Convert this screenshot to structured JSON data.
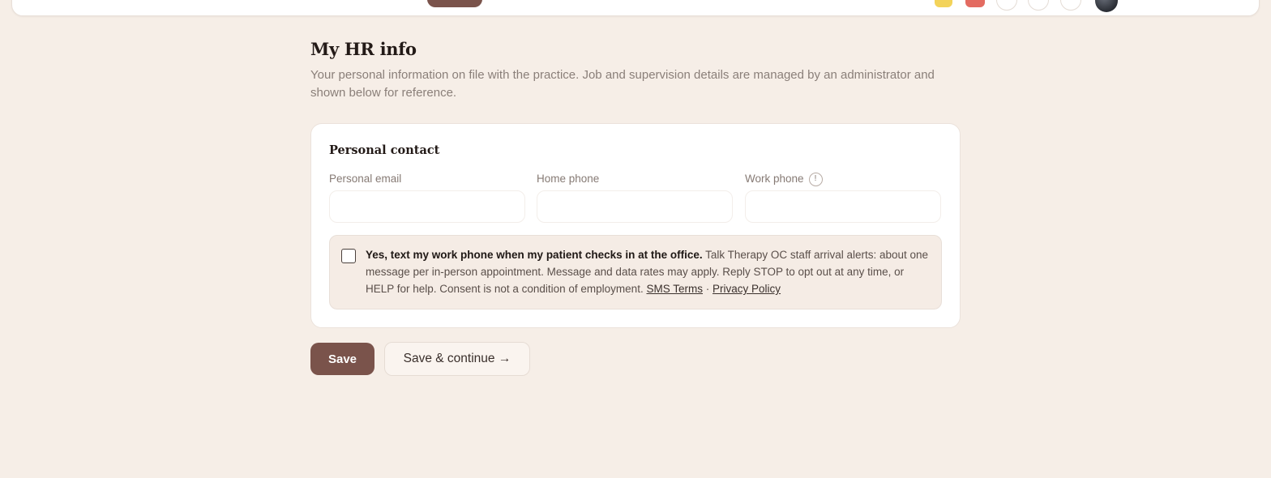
{
  "page": {
    "title": "My HR info",
    "subtitle": "Your personal information on file with the practice. Job and supervision details are managed by an administrator and shown below for reference."
  },
  "personal_contact": {
    "title": "Personal contact",
    "fields": [
      {
        "label": "Personal email",
        "value": "",
        "placeholder": ""
      },
      {
        "label": "Home phone",
        "value": "",
        "placeholder": ""
      },
      {
        "label": "Work phone",
        "value": "",
        "placeholder": "",
        "info_icon": "info-icon"
      }
    ],
    "info_glyph": "!",
    "consent": {
      "checked": false,
      "lead": "Yes, text my work phone when my patient checks in at the office.",
      "body": "Talk Therapy OC staff arrival alerts: about one message per in-person appointment. Message and data rates may apply. Reply STOP to opt out at any time, or HELP for help. Consent is not a condition of employment.",
      "sms_terms_link": "SMS Terms",
      "separator": "·",
      "privacy_link": "Privacy Policy"
    }
  },
  "actions": {
    "save_label": "Save",
    "save_continue_label": "Save & continue →"
  },
  "colors": {
    "background": "#f6eee7",
    "primary": "#7a534b",
    "consent_bg": "#f5ece5",
    "indicator_yellow": "#f3d35a",
    "indicator_red": "#e36b61"
  }
}
